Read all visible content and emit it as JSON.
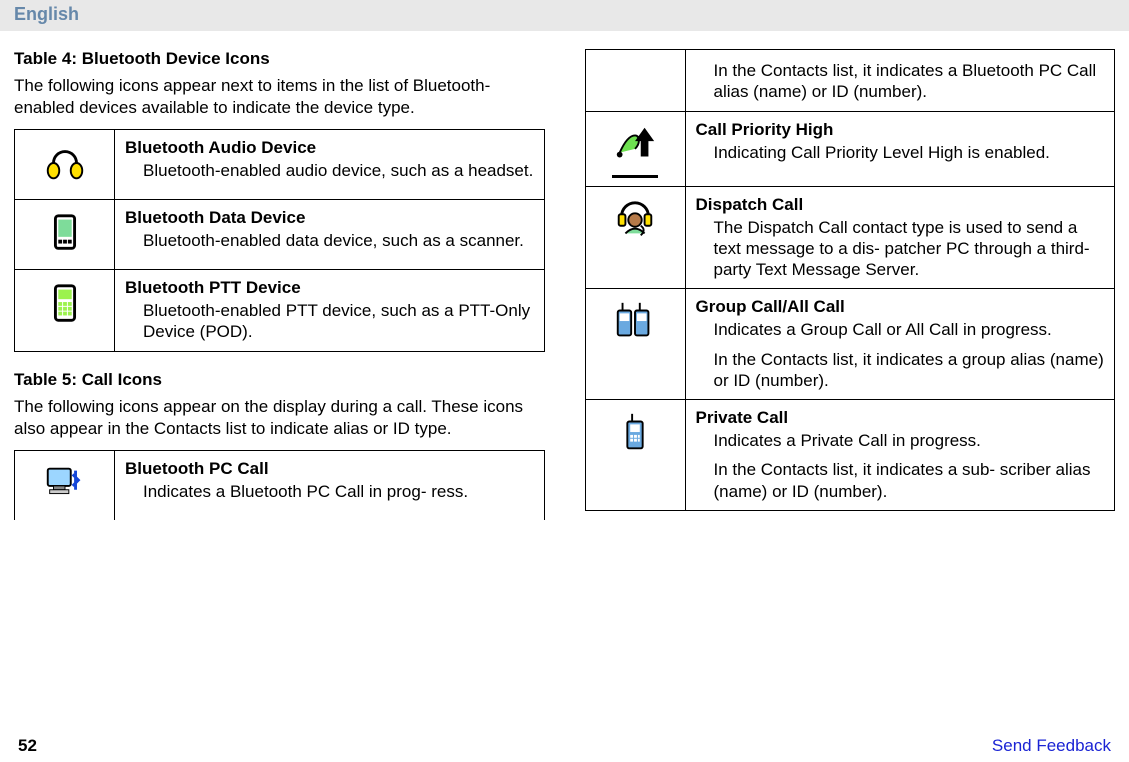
{
  "lang": "English",
  "page_number": "52",
  "feedback_link": "Send Feedback",
  "table4": {
    "caption": "Table 4: Bluetooth Device Icons",
    "intro": "The following icons appear next to items in the list of Bluetooth-enabled devices available to indicate the device type.",
    "rows": [
      {
        "icon_name": "headset-icon",
        "title": "Bluetooth Audio Device",
        "desc": "Bluetooth-enabled audio device, such as a headset."
      },
      {
        "icon_name": "pda-icon",
        "title": "Bluetooth Data Device",
        "desc": "Bluetooth-enabled data device, such as a scanner."
      },
      {
        "icon_name": "ptt-device-icon",
        "title": "Bluetooth PTT Device",
        "desc": "Bluetooth-enabled PTT device, such as a PTT-Only Device (POD)."
      }
    ]
  },
  "table5": {
    "caption": "Table 5: Call Icons",
    "intro": "The following icons appear on the display during a call. These icons also appear in the Contacts list to indicate alias or ID type.",
    "rows": [
      {
        "icon_name": "bt-pc-call-icon",
        "title": "Bluetooth PC Call",
        "desc": "Indicates a Bluetooth PC Call in prog- ress.",
        "desc2": "In the Contacts list, it indicates a Bluetooth PC Call alias (name) or ID (number)."
      },
      {
        "icon_name": "call-priority-high-icon",
        "title": "Call Priority High",
        "desc": "Indicating Call Priority Level High is enabled."
      },
      {
        "icon_name": "dispatch-call-icon",
        "title": "Dispatch Call",
        "desc": "The Dispatch Call contact type is used to send a text message to a dis- patcher PC through a third-party Text Message Server."
      },
      {
        "icon_name": "group-call-icon",
        "title": "Group Call/All Call",
        "desc": "Indicates a Group Call or All Call in progress.",
        "desc2": "In the Contacts list, it indicates a group alias (name) or ID (number)."
      },
      {
        "icon_name": "private-call-icon",
        "title": "Private Call",
        "desc": "Indicates a Private Call in progress.",
        "desc2": "In the Contacts list, it indicates a sub- scriber alias (name) or ID (number)."
      }
    ]
  }
}
